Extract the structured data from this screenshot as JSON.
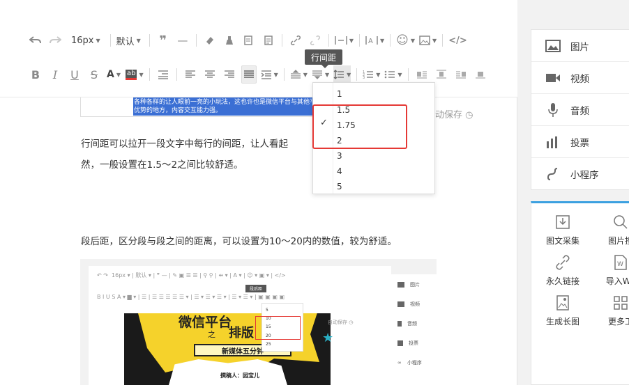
{
  "toolbar": {
    "font_size": "16px",
    "font_family": "默认",
    "highlight_letters": "ab",
    "tooltip": "行间距"
  },
  "line_height_menu": {
    "options": [
      "1",
      "1.5",
      "1.75",
      "2",
      "3",
      "4",
      "5"
    ],
    "selected": "1.75"
  },
  "editor": {
    "selected_text": "各种各样的让人眼前一亮的小玩法，这也许也是微信平台与其他平台",
    "selected_text_line2": "优势的地方，内容交互能力强。",
    "autosave": "动保存",
    "para1_line1": "行间距可以拉开一段文字中每行的间距，让人看起",
    "para1_line2": "然，一般设置在1.5～2之间比较舒适。",
    "para2": "段后距，区分段与段之间的距离，可以设置为10～20内的数值，较为舒适。"
  },
  "embedded": {
    "font_size": "16px",
    "font_family": "默认",
    "tooltip": "段后距",
    "options": [
      "5",
      "10",
      "15",
      "20",
      "25"
    ],
    "autosave": "自动保存",
    "poster_title": "微信平台",
    "poster_zhi": "之",
    "poster_paiban": "排版",
    "poster_banner": "新媒体五分钟",
    "poster_author": "撰稿人：园宝儿",
    "side_items": [
      "图片",
      "视频",
      "音频",
      "投票",
      "小程序"
    ]
  },
  "sidebar": {
    "media": [
      {
        "label": "图片",
        "icon": "image-icon"
      },
      {
        "label": "视频",
        "icon": "video-icon"
      },
      {
        "label": "音频",
        "icon": "microphone-icon"
      },
      {
        "label": "投票",
        "icon": "poll-icon"
      },
      {
        "label": "小程序",
        "icon": "miniprogram-icon"
      }
    ],
    "tools": [
      {
        "label": "图文采集",
        "icon": "download-icon"
      },
      {
        "label": "图片搜",
        "icon": "search-icon"
      },
      {
        "label": "永久链接",
        "icon": "link-icon"
      },
      {
        "label": "导入Wo",
        "icon": "word-icon"
      },
      {
        "label": "生成长图",
        "icon": "long-image-icon"
      },
      {
        "label": "更多工",
        "icon": "grid-icon"
      }
    ]
  },
  "colors": {
    "accent": "#3ca0e0",
    "selection": "#3b6fd4",
    "highlight_red": "#e53935"
  }
}
